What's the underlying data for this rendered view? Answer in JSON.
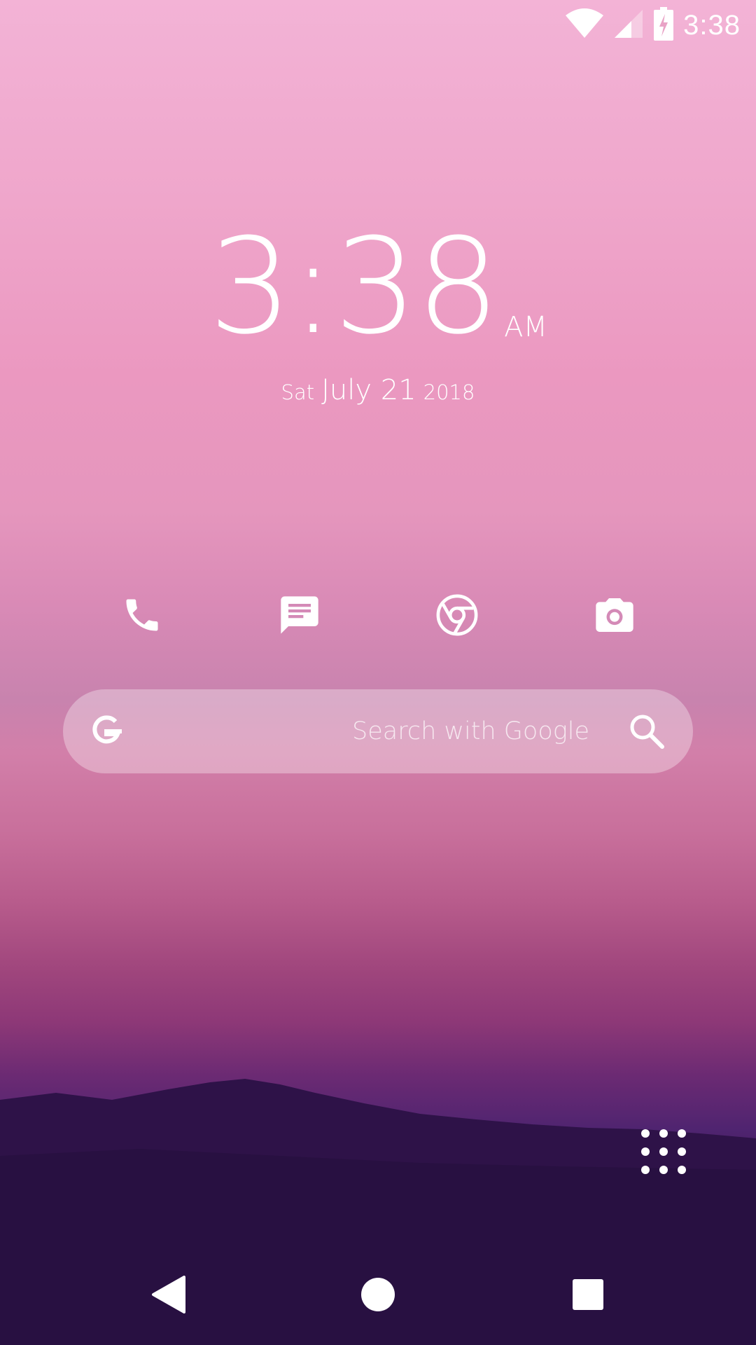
{
  "status_bar": {
    "time": "3:38",
    "icons": [
      "wifi-icon",
      "cell-signal-icon",
      "battery-charging-icon"
    ]
  },
  "clock_widget": {
    "time": "3:38",
    "ampm": "AM",
    "day_of_week": "Sat",
    "month_day": "July 21",
    "year": "2018"
  },
  "dock": {
    "apps": [
      {
        "name": "Phone",
        "icon": "phone-icon"
      },
      {
        "name": "Messages",
        "icon": "message-icon"
      },
      {
        "name": "Chrome",
        "icon": "chrome-icon"
      },
      {
        "name": "Camera",
        "icon": "camera-icon"
      }
    ]
  },
  "search_bar": {
    "placeholder": "Search with Google",
    "logo_icon": "google-g-icon",
    "action_icon": "search-icon"
  },
  "app_drawer": {
    "icon": "apps-grid-icon"
  },
  "nav_bar": {
    "buttons": [
      "back-icon",
      "home-icon",
      "recents-icon"
    ]
  },
  "colors": {
    "sky_top": "#f3b3d6",
    "sky_mid": "#e596bd",
    "horizon": "#8d3877",
    "hills": "#2a0f3c",
    "foreground": "#ffffff"
  }
}
